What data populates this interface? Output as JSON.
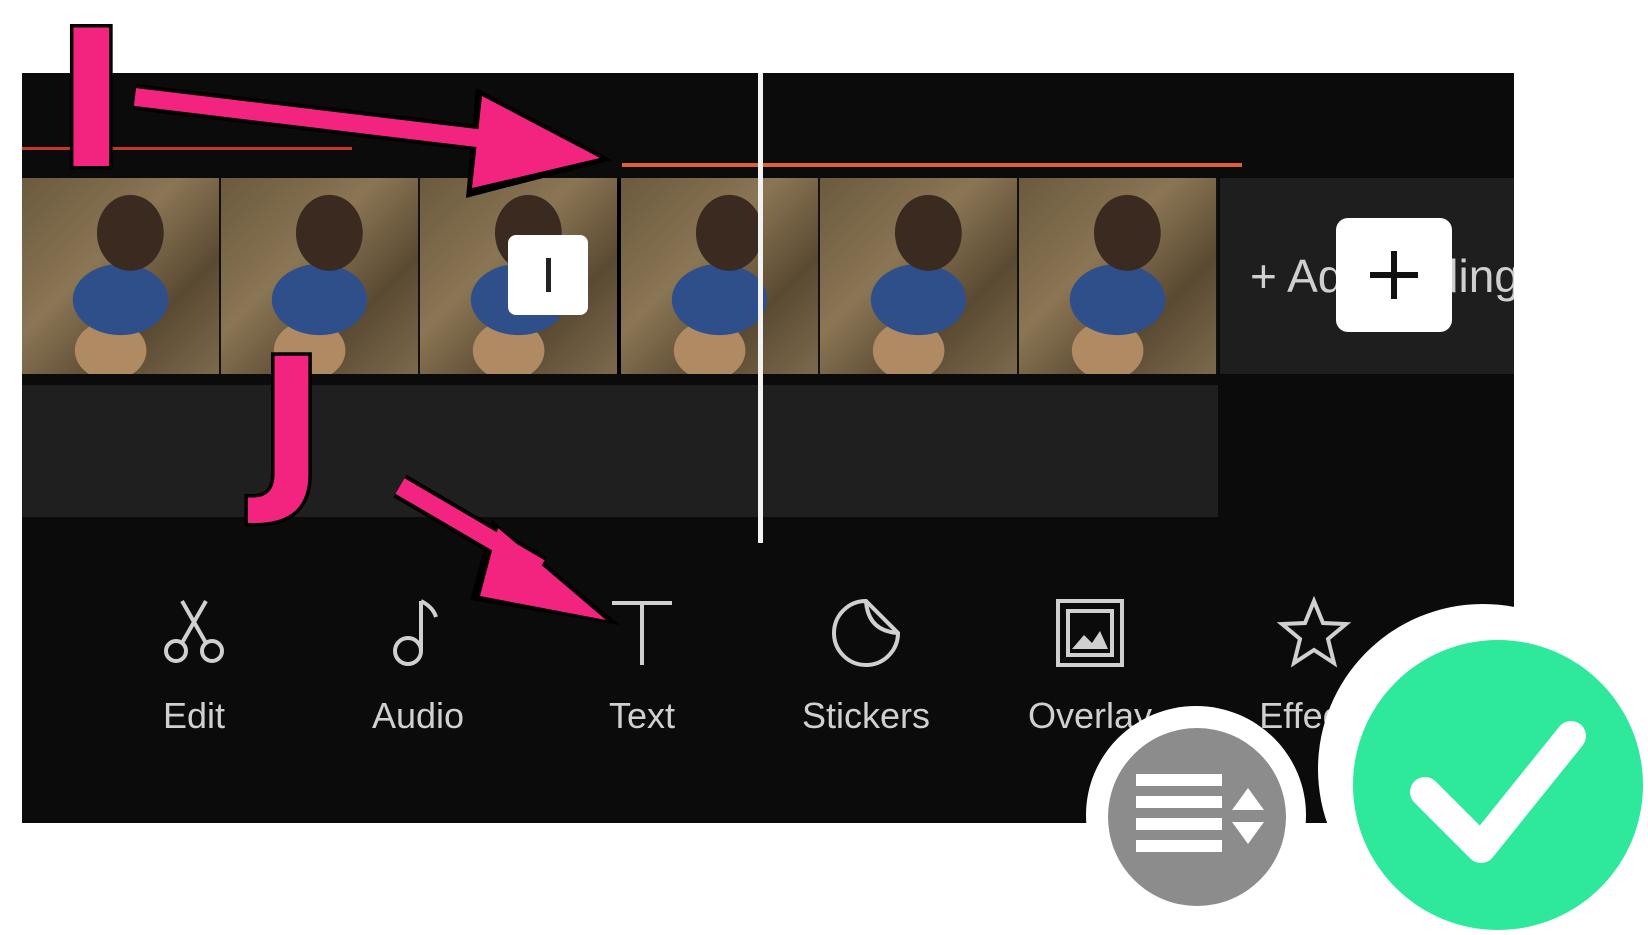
{
  "timeline": {
    "add_clip_label": "+ Add ending"
  },
  "toolbar": {
    "items": [
      {
        "label": "Edit",
        "icon": "scissors-icon"
      },
      {
        "label": "Audio",
        "icon": "music-note-icon"
      },
      {
        "label": "Text",
        "icon": "text-icon"
      },
      {
        "label": "Stickers",
        "icon": "sticker-icon"
      },
      {
        "label": "Overlay",
        "icon": "overlay-image-icon"
      },
      {
        "label": "Effects",
        "icon": "star-icon"
      }
    ]
  },
  "annotations": {
    "letter_i": "I",
    "letter_j": "J",
    "color": "#f2247f"
  },
  "badges": {
    "list_icon": "list-reorder-icon",
    "check_icon": "checkmark-icon",
    "check_color": "#2ee89b"
  }
}
